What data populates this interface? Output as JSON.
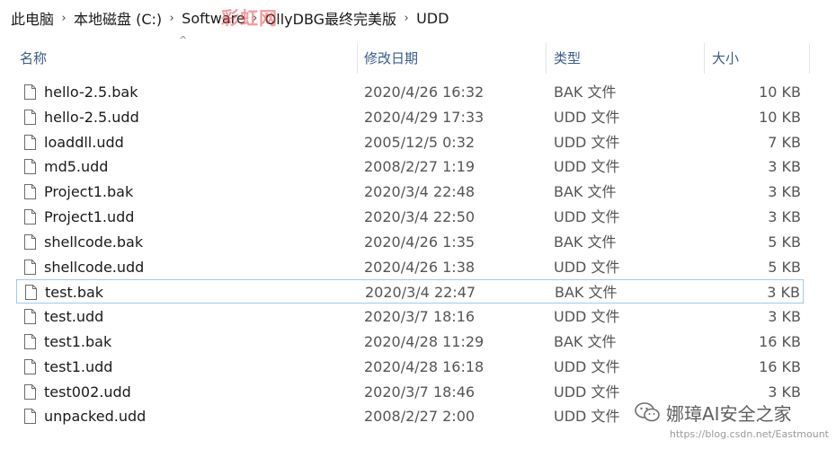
{
  "breadcrumb": [
    "此电脑",
    "本地磁盘 (C:)",
    "Software",
    "OllyDBG最终完美版",
    "UDD"
  ],
  "watermark_top": "彩虹网",
  "columns": {
    "name": "名称",
    "date": "修改日期",
    "type": "类型",
    "size": "大小"
  },
  "files": [
    {
      "name": "hello-2.5.bak",
      "date": "2020/4/26 16:32",
      "type": "BAK 文件",
      "size": "10 KB"
    },
    {
      "name": "hello-2.5.udd",
      "date": "2020/4/29 17:33",
      "type": "UDD 文件",
      "size": "10 KB"
    },
    {
      "name": "loaddll.udd",
      "date": "2005/12/5 0:32",
      "type": "UDD 文件",
      "size": "7 KB"
    },
    {
      "name": "md5.udd",
      "date": "2008/2/27 1:19",
      "type": "UDD 文件",
      "size": "3 KB"
    },
    {
      "name": "Project1.bak",
      "date": "2020/3/4 22:48",
      "type": "BAK 文件",
      "size": "3 KB"
    },
    {
      "name": "Project1.udd",
      "date": "2020/3/4 22:50",
      "type": "UDD 文件",
      "size": "3 KB"
    },
    {
      "name": "shellcode.bak",
      "date": "2020/4/26 1:35",
      "type": "BAK 文件",
      "size": "5 KB"
    },
    {
      "name": "shellcode.udd",
      "date": "2020/4/26 1:38",
      "type": "UDD 文件",
      "size": "5 KB"
    },
    {
      "name": "test.bak",
      "date": "2020/3/4 22:47",
      "type": "BAK 文件",
      "size": "3 KB",
      "selected": true
    },
    {
      "name": "test.udd",
      "date": "2020/3/7 18:16",
      "type": "UDD 文件",
      "size": "3 KB"
    },
    {
      "name": "test1.bak",
      "date": "2020/4/28 11:29",
      "type": "BAK 文件",
      "size": "16 KB"
    },
    {
      "name": "test1.udd",
      "date": "2020/4/28 16:18",
      "type": "UDD 文件",
      "size": "16 KB"
    },
    {
      "name": "test002.udd",
      "date": "2020/3/7 18:46",
      "type": "UDD 文件",
      "size": "3 KB"
    },
    {
      "name": "unpacked.udd",
      "date": "2008/2/27 2:00",
      "type": "UDD 文件",
      "size": ""
    }
  ],
  "watermark_brand": "娜璋AI安全之家",
  "watermark_url": "https://blog.csdn.net/Eastmount",
  "colors": {
    "header_text": "#3a5b8a",
    "selection_border": "#9fc9ee"
  }
}
